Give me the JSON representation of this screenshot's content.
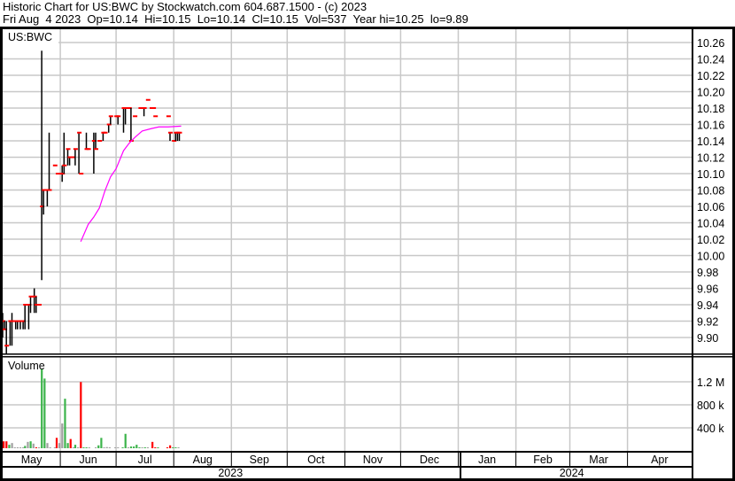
{
  "header": {
    "title": "Historic Chart for US:BWC by Stockwatch.com 604.687.1500 - (c) 2023",
    "quote": "Fri Aug  4 2023  Op=10.14  Hi=10.15  Lo=10.14  Cl=10.15  Vol=537  Year hi=10.25  lo=9.89"
  },
  "colors": {
    "up": "#3cb44b",
    "down": "#ff0000",
    "flat": "#a0a0a0",
    "ma": "#ff00ff",
    "grid": "#c8c8c8",
    "close_tick": "#ff0000"
  },
  "chart_data": {
    "type": "ohlc",
    "symbol_label": "US:BWC",
    "volume_label": "Volume",
    "x_unit": "days since May 1 2023",
    "price_ticks": [
      "10.26",
      "10.24",
      "10.22",
      "10.20",
      "10.18",
      "10.16",
      "10.14",
      "10.12",
      "10.10",
      "10.08",
      "10.06",
      "10.04",
      "10.02",
      "10.00",
      "9.98",
      "9.96",
      "9.94",
      "9.92",
      "9.90"
    ],
    "price_range": [
      9.886,
      10.274
    ],
    "volume_ticks": [
      "1.2 M",
      "800 k",
      "400 k"
    ],
    "volume_tick_values_k": [
      1200,
      800,
      400
    ],
    "months": [
      {
        "label": "May",
        "day": 0
      },
      {
        "label": "Jun",
        "day": 31
      },
      {
        "label": "Jul",
        "day": 61
      },
      {
        "label": "Aug",
        "day": 92
      },
      {
        "label": "Sep",
        "day": 123
      },
      {
        "label": "Oct",
        "day": 153
      },
      {
        "label": "Nov",
        "day": 184
      },
      {
        "label": "Dec",
        "day": 214
      },
      {
        "label": "Jan",
        "day": 245
      },
      {
        "label": "Feb",
        "day": 276
      },
      {
        "label": "Mar",
        "day": 305
      },
      {
        "label": "Apr",
        "day": 336
      }
    ],
    "years": [
      {
        "label": "2023",
        "start": 0,
        "end": 245
      },
      {
        "label": "2024",
        "start": 245,
        "end": 367
      }
    ],
    "bars_hlc": [
      [
        0,
        9.93,
        9.9,
        9.92
      ],
      [
        1,
        9.92,
        9.91,
        9.91
      ],
      [
        2,
        9.92,
        9.88,
        9.89
      ],
      [
        4,
        9.92,
        9.89,
        9.92
      ],
      [
        5,
        9.93,
        9.89,
        9.92
      ],
      [
        7,
        9.92,
        9.91,
        9.92
      ],
      [
        8,
        9.92,
        9.91,
        9.92
      ],
      [
        9.5,
        9.92,
        9.91,
        9.92
      ],
      [
        11,
        9.92,
        9.91,
        9.92
      ],
      [
        12,
        9.94,
        9.91,
        9.94
      ],
      [
        14,
        9.94,
        9.91,
        9.94
      ],
      [
        15,
        9.95,
        9.93,
        9.95
      ],
      [
        17,
        9.96,
        9.93,
        9.95
      ],
      [
        18,
        9.95,
        9.93,
        9.94
      ],
      [
        19.5,
        9.94,
        9.94,
        9.94
      ],
      [
        21,
        10.25,
        9.97,
        10.06
      ],
      [
        22,
        10.08,
        10.05,
        10.08
      ],
      [
        24,
        10.08,
        10.06,
        10.08
      ],
      [
        25,
        10.15,
        10.08,
        10.08
      ],
      [
        28,
        10.11,
        10.11,
        10.11
      ],
      [
        29.5,
        10.1,
        10.1,
        10.1
      ],
      [
        31,
        10.1,
        10.1,
        10.1
      ],
      [
        32,
        10.11,
        10.09,
        10.1
      ],
      [
        33,
        10.15,
        10.1,
        10.11
      ],
      [
        35,
        10.13,
        10.11,
        10.13
      ],
      [
        36,
        10.12,
        10.11,
        10.12
      ],
      [
        37.5,
        10.12,
        10.12,
        10.12
      ],
      [
        39,
        10.13,
        10.11,
        10.13
      ],
      [
        41,
        10.15,
        10.1,
        10.15
      ],
      [
        42,
        10.1,
        10.1,
        10.1
      ],
      [
        45,
        10.15,
        10.13,
        10.13
      ],
      [
        46,
        10.13,
        10.13,
        10.13
      ],
      [
        49,
        10.15,
        10.1,
        10.14
      ],
      [
        50,
        10.15,
        10.13,
        10.13
      ],
      [
        52,
        10.14,
        10.14,
        10.14
      ],
      [
        54,
        10.15,
        10.14,
        10.15
      ],
      [
        55,
        10.15,
        10.15,
        10.15
      ],
      [
        57,
        10.16,
        10.15,
        10.16
      ],
      [
        58,
        10.17,
        10.16,
        10.17
      ],
      [
        61,
        10.17,
        10.17,
        10.17
      ],
      [
        62,
        10.17,
        10.16,
        10.17
      ],
      [
        65,
        10.18,
        10.15,
        10.18
      ],
      [
        66,
        10.18,
        10.16,
        10.18
      ],
      [
        68,
        10.18,
        10.18,
        10.18
      ],
      [
        69,
        10.18,
        10.14,
        10.14
      ],
      [
        71,
        10.17,
        10.17,
        10.17
      ],
      [
        74,
        10.18,
        10.18,
        10.18
      ],
      [
        76,
        10.18,
        10.17,
        10.18
      ],
      [
        78,
        10.19,
        10.19,
        10.19
      ],
      [
        80,
        10.18,
        10.18,
        10.18
      ],
      [
        81,
        10.18,
        10.18,
        10.18
      ],
      [
        82,
        10.17,
        10.17,
        10.17
      ],
      [
        89,
        10.17,
        10.17,
        10.17
      ],
      [
        90,
        10.15,
        10.14,
        10.15
      ],
      [
        92,
        10.14,
        10.14,
        10.14
      ],
      [
        93,
        10.15,
        10.14,
        10.15
      ],
      [
        94,
        10.15,
        10.14,
        10.15
      ],
      [
        95,
        10.15,
        10.14,
        10.15
      ]
    ],
    "moving_average": [
      [
        42,
        10.017
      ],
      [
        46,
        10.038
      ],
      [
        49,
        10.047
      ],
      [
        52,
        10.058
      ],
      [
        55,
        10.079
      ],
      [
        58,
        10.096
      ],
      [
        61,
        10.106
      ],
      [
        65,
        10.128
      ],
      [
        68,
        10.137
      ],
      [
        71,
        10.144
      ],
      [
        75,
        10.152
      ],
      [
        80,
        10.155
      ],
      [
        84,
        10.157
      ],
      [
        89,
        10.157
      ],
      [
        96,
        10.158
      ]
    ],
    "volume_k": [
      [
        -0.5,
        60,
        "flat"
      ],
      [
        0.5,
        120,
        "down"
      ],
      [
        2,
        120,
        "down"
      ],
      [
        3.5,
        60,
        "up"
      ],
      [
        5,
        90,
        "flat"
      ],
      [
        6.5,
        15,
        "flat"
      ],
      [
        8,
        15,
        "flat"
      ],
      [
        9.5,
        15,
        "flat"
      ],
      [
        11,
        15,
        "flat"
      ],
      [
        12,
        40,
        "up"
      ],
      [
        13.5,
        110,
        "flat"
      ],
      [
        15,
        120,
        "up"
      ],
      [
        16.5,
        80,
        "flat"
      ],
      [
        18,
        15,
        "down"
      ],
      [
        19.5,
        15,
        "flat"
      ],
      [
        21,
        1380,
        "up"
      ],
      [
        22.5,
        1210,
        "up"
      ],
      [
        24,
        90,
        "flat"
      ],
      [
        25.5,
        15,
        "flat"
      ],
      [
        28,
        15,
        "flat"
      ],
      [
        29,
        180,
        "down"
      ],
      [
        30.5,
        90,
        "flat"
      ],
      [
        32,
        430,
        "flat"
      ],
      [
        33.5,
        860,
        "up"
      ],
      [
        35,
        90,
        "up"
      ],
      [
        36.5,
        160,
        "down"
      ],
      [
        38,
        15,
        "flat"
      ],
      [
        39,
        60,
        "up"
      ],
      [
        40.5,
        15,
        "flat"
      ],
      [
        42,
        1150,
        "down"
      ],
      [
        43.5,
        15,
        "up"
      ],
      [
        45,
        15,
        "up"
      ],
      [
        46.5,
        15,
        "flat"
      ],
      [
        50,
        15,
        "flat"
      ],
      [
        51.5,
        50,
        "up"
      ],
      [
        53,
        180,
        "up"
      ],
      [
        54.5,
        15,
        "flat"
      ],
      [
        56,
        20,
        "flat"
      ],
      [
        57.5,
        15,
        "flat"
      ],
      [
        60.5,
        15,
        "flat"
      ],
      [
        62,
        15,
        "flat"
      ],
      [
        64.5,
        15,
        "up"
      ],
      [
        66,
        250,
        "up"
      ],
      [
        67.5,
        15,
        "flat"
      ],
      [
        69,
        30,
        "up"
      ],
      [
        70.5,
        30,
        "up"
      ],
      [
        72,
        60,
        "up"
      ],
      [
        73.5,
        15,
        "up"
      ],
      [
        75,
        15,
        "flat"
      ],
      [
        76.5,
        15,
        "up"
      ],
      [
        78,
        15,
        "flat"
      ],
      [
        80.5,
        110,
        "down"
      ],
      [
        82,
        15,
        "down"
      ],
      [
        83.5,
        15,
        "up"
      ],
      [
        88.5,
        15,
        "down"
      ],
      [
        90,
        50,
        "down"
      ],
      [
        91.5,
        15,
        "up"
      ],
      [
        93,
        15,
        "up"
      ],
      [
        94.5,
        15,
        "flat"
      ]
    ]
  }
}
